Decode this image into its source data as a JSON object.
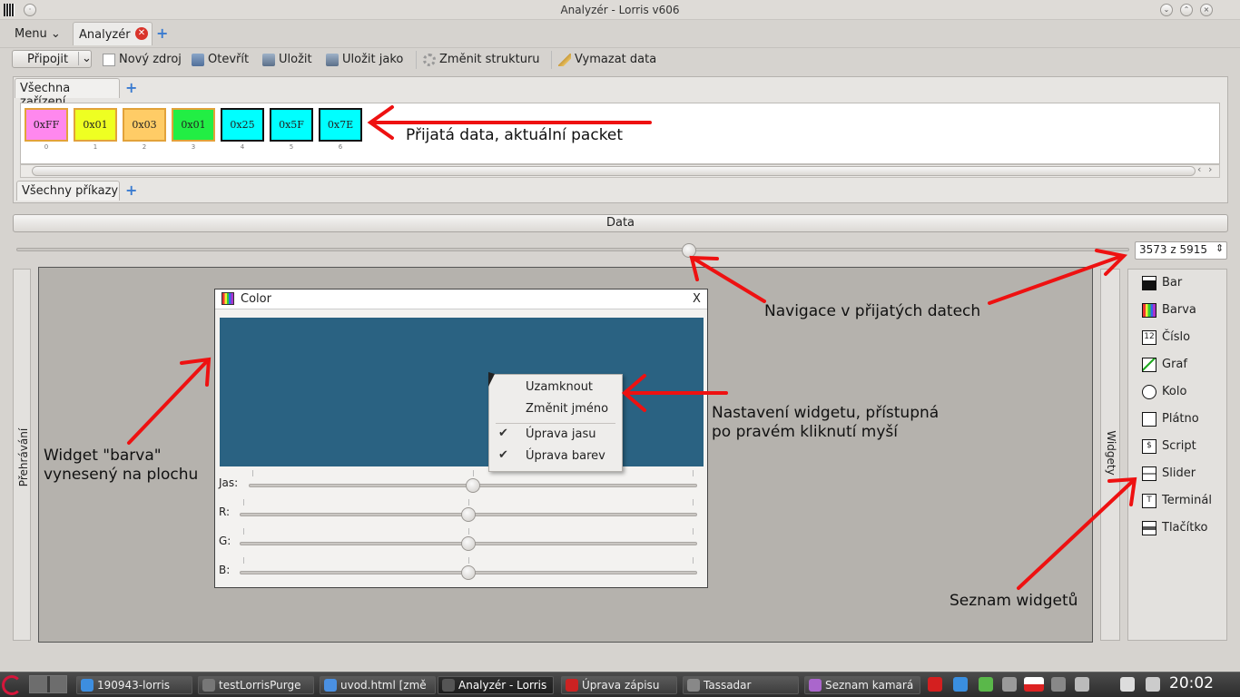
{
  "window": {
    "title": "Analyzér - Lorris v606"
  },
  "menubar": {
    "menu_label": "Menu",
    "tab_label": "Analyzér",
    "add_tab": "+"
  },
  "toolbar": {
    "connect": "Připojit",
    "new_source": "Nový zdroj",
    "open": "Otevřít",
    "save": "Uložit",
    "save_as": "Uložit jako",
    "change_structure": "Změnit strukturu",
    "clear_data": "Vymazat data"
  },
  "devices": {
    "tab_label": "Všechna zařízení",
    "bytes": [
      {
        "value": "0xFF",
        "index": "0",
        "color": "#ff88ee"
      },
      {
        "value": "0x01",
        "index": "1",
        "color": "#eeff22"
      },
      {
        "value": "0x03",
        "index": "2",
        "color": "#ffcc66"
      },
      {
        "value": "0x01",
        "index": "3",
        "color": "#22ee44"
      },
      {
        "value": "0x25",
        "index": "4",
        "color": "#00ffff"
      },
      {
        "value": "0x5F",
        "index": "5",
        "color": "#00ffff"
      },
      {
        "value": "0x7E",
        "index": "6",
        "color": "#00ffff"
      }
    ],
    "commands_tab_label": "Všechny příkazy"
  },
  "data_bar": {
    "label": "Data"
  },
  "navigation": {
    "position": 3573,
    "total": 5915,
    "spin_text": "3573 z 5915"
  },
  "side_left": {
    "label": "Přehrávání"
  },
  "side_right": {
    "label": "Widgety"
  },
  "color_widget": {
    "title": "Color",
    "close": "X",
    "preview_color": "#2a6282",
    "sliders": [
      {
        "label": "Jas:",
        "value": 0.5
      },
      {
        "label": "R:",
        "value": 0.5
      },
      {
        "label": "G:",
        "value": 0.5
      },
      {
        "label": "B:",
        "value": 0.5
      }
    ]
  },
  "context_menu": {
    "items": [
      {
        "label": "Uzamknout",
        "checked": false
      },
      {
        "label": "Změnit jméno",
        "checked": false
      },
      {
        "label": "Úprava jasu",
        "checked": true
      },
      {
        "label": "Úprava barev",
        "checked": true
      }
    ]
  },
  "widgets_list": [
    {
      "label": "Bar",
      "icon": "bar-icon"
    },
    {
      "label": "Barva",
      "icon": "color-icon"
    },
    {
      "label": "Číslo",
      "icon": "number-icon",
      "glyph": "12"
    },
    {
      "label": "Graf",
      "icon": "graph-icon"
    },
    {
      "label": "Kolo",
      "icon": "circle-icon"
    },
    {
      "label": "Plátno",
      "icon": "canvas-icon"
    },
    {
      "label": "Script",
      "icon": "script-icon",
      "glyph": "$"
    },
    {
      "label": "Slider",
      "icon": "slider-icon"
    },
    {
      "label": "Terminál",
      "icon": "terminal-icon",
      "glyph": "T"
    },
    {
      "label": "Tlačítko",
      "icon": "button-icon"
    }
  ],
  "annotations": {
    "received": "Přijatá data, aktuální packet",
    "navigation": "Navigace v přijatých datech",
    "settings_line1": "Nastavení widgetu, přístupná",
    "settings_line2": "po pravém kliknutí myší",
    "widget_line1": "Widget \"barva\"",
    "widget_line2": "vynesený na plochu",
    "widget_list": "Seznam widgetů"
  },
  "taskbar": {
    "tasks": [
      {
        "label": "190943-lorris",
        "color": "#3d8ee0"
      },
      {
        "label": "testLorrisPurge",
        "color": "#777777"
      },
      {
        "label": "uvod.html [změ",
        "color": "#4a90e2"
      },
      {
        "label": "Analyzér - Lorris",
        "color": "#555555"
      },
      {
        "label": "Úprava zápisu",
        "color": "#cc2222"
      },
      {
        "label": "Tassadar",
        "color": "#888888"
      },
      {
        "label": "Seznam kamará",
        "color": "#aa66cc"
      }
    ],
    "clock": "20:02"
  }
}
